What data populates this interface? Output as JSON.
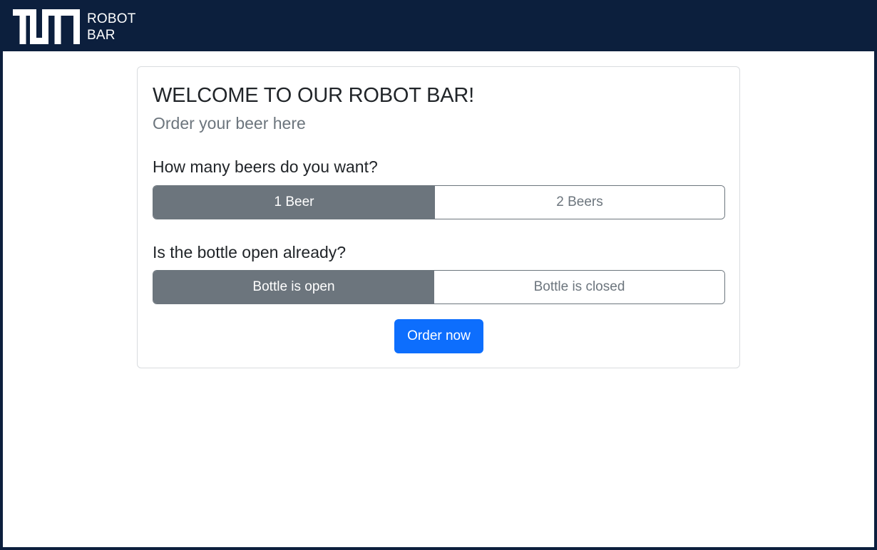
{
  "navbar": {
    "logo_text": "TUM",
    "brand_line1": "ROBOT",
    "brand_line2": "BAR"
  },
  "card": {
    "title": "WELCOME TO OUR ROBOT BAR!",
    "subtitle": "Order your beer here",
    "beer_question": "How many beers do you want?",
    "beer_options": [
      {
        "label": "1 Beer",
        "selected": true
      },
      {
        "label": "2 Beers",
        "selected": false
      }
    ],
    "bottle_question": "Is the bottle open already?",
    "bottle_options": [
      {
        "label": "Bottle is open",
        "selected": true
      },
      {
        "label": "Bottle is closed",
        "selected": false
      }
    ],
    "order_button": "Order now"
  },
  "colors": {
    "navbar_bg": "#0c1f3d",
    "selected_bg": "#6c757d",
    "primary": "#0d6efd"
  }
}
